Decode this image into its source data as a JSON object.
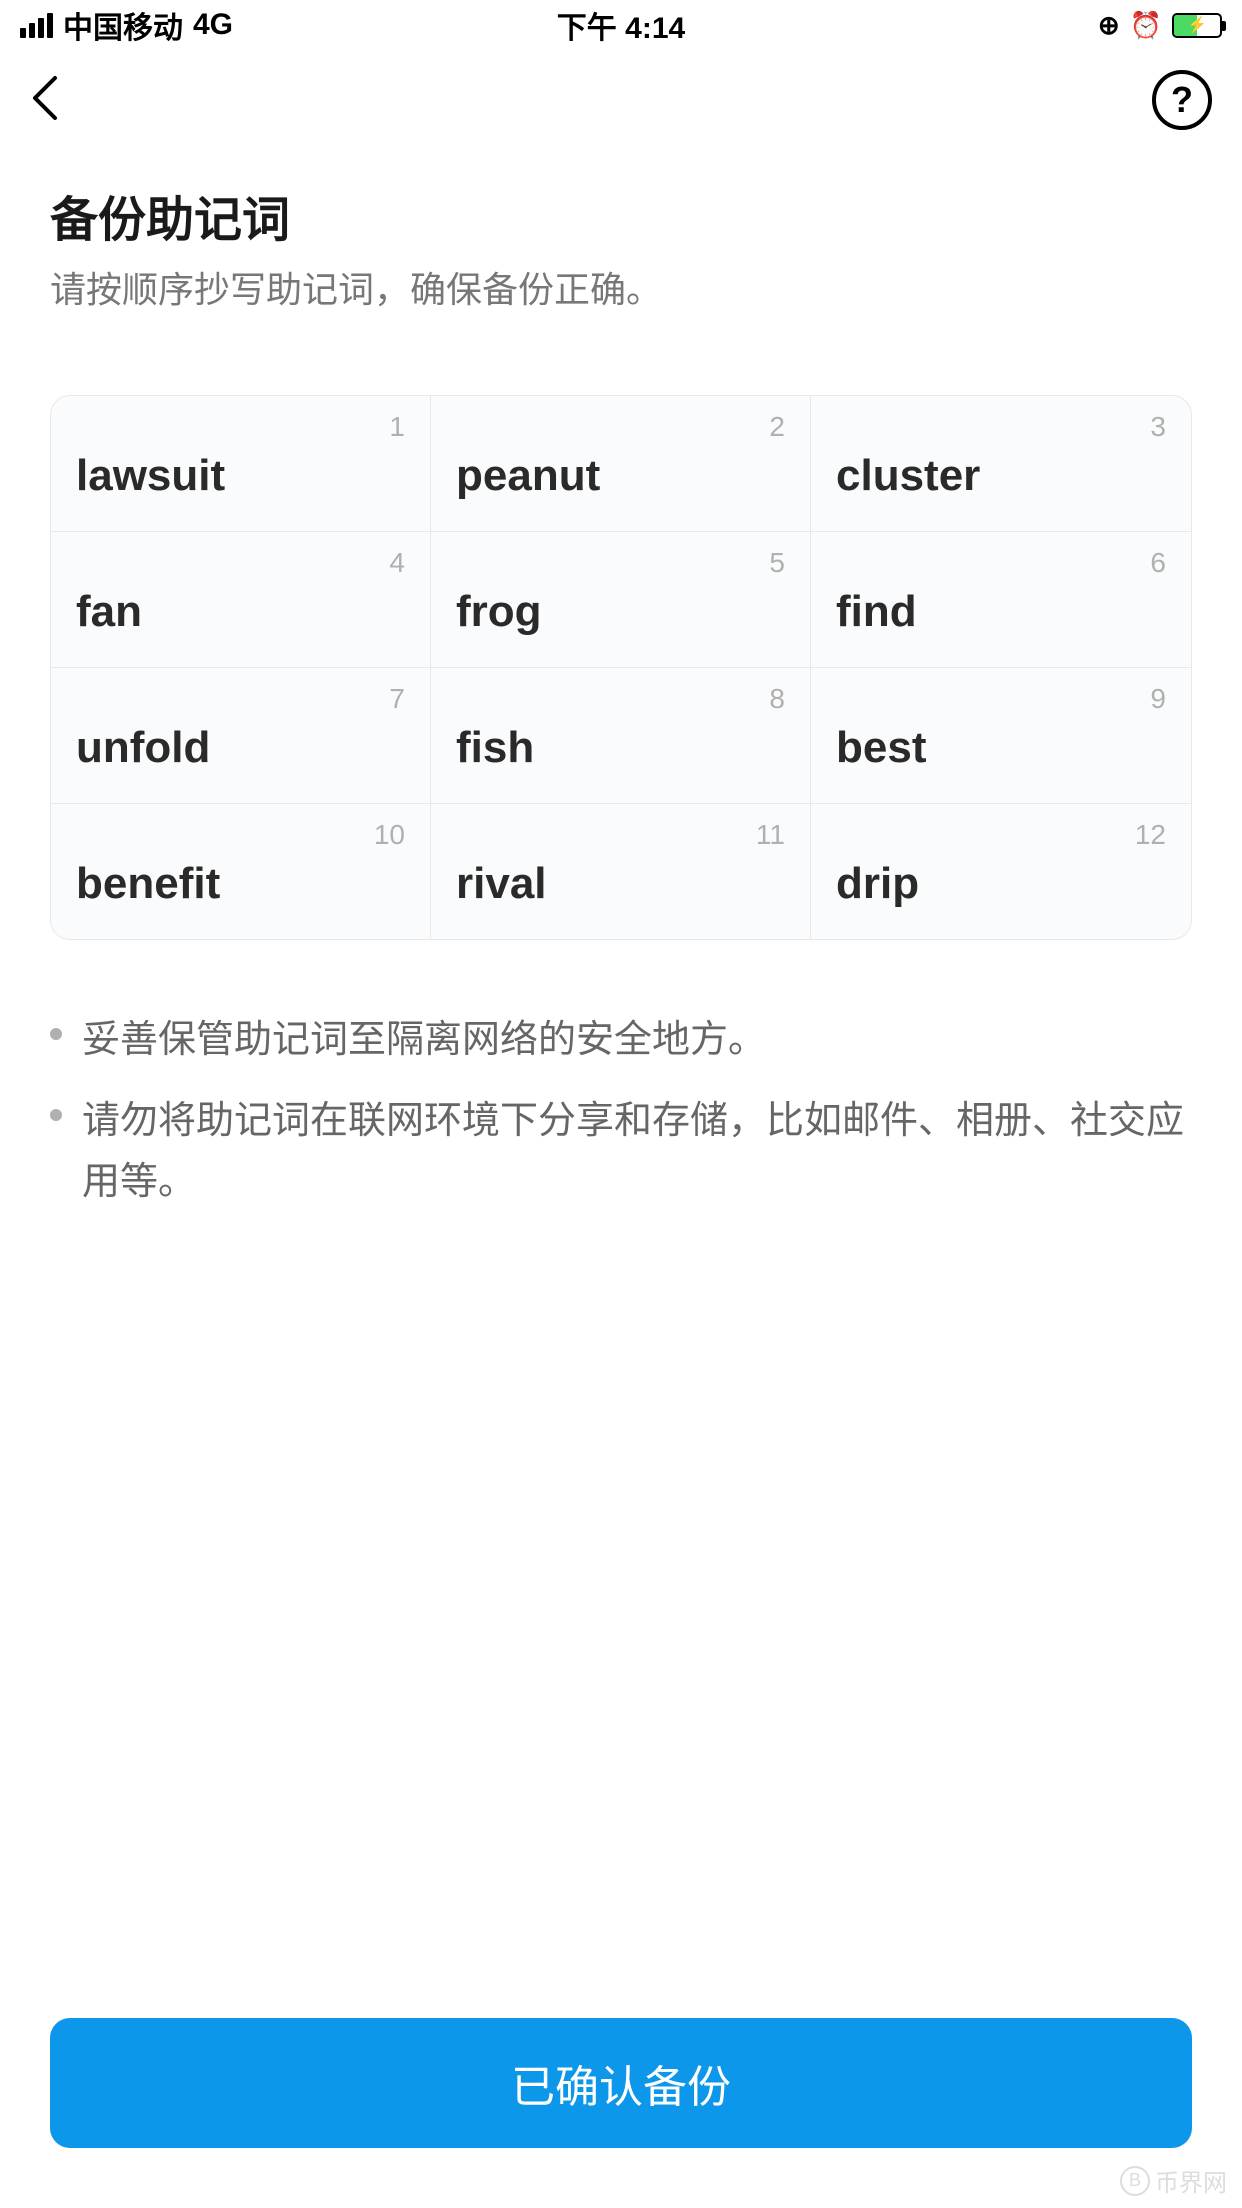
{
  "statusBar": {
    "carrier": "中国移动",
    "network": "4G",
    "time": "下午 4:14"
  },
  "header": {
    "title": "备份助记词",
    "subtitle": "请按顺序抄写助记词，确保备份正确。"
  },
  "mnemonic": [
    {
      "index": "1",
      "word": "lawsuit"
    },
    {
      "index": "2",
      "word": "peanut"
    },
    {
      "index": "3",
      "word": "cluster"
    },
    {
      "index": "4",
      "word": "fan"
    },
    {
      "index": "5",
      "word": "frog"
    },
    {
      "index": "6",
      "word": "find"
    },
    {
      "index": "7",
      "word": "unfold"
    },
    {
      "index": "8",
      "word": "fish"
    },
    {
      "index": "9",
      "word": "best"
    },
    {
      "index": "10",
      "word": "benefit"
    },
    {
      "index": "11",
      "word": "rival"
    },
    {
      "index": "12",
      "word": "drip"
    }
  ],
  "tips": [
    "妥善保管助记词至隔离网络的安全地方。",
    "请勿将助记词在联网环境下分享和存储，比如邮件、相册、社交应用等。"
  ],
  "confirmButton": "已确认备份",
  "watermark": "币界网"
}
